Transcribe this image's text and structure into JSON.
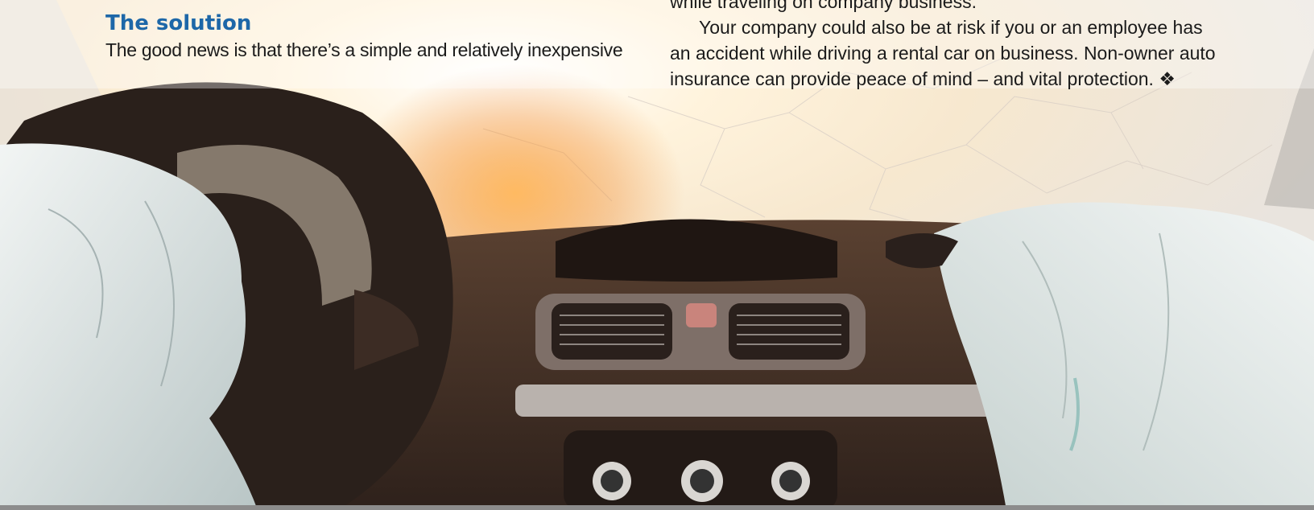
{
  "article": {
    "heading": "The solution",
    "left_text": "The good news is that there’s a simple and relatively inexpensive",
    "right_line_clipped": "while traveling on company business.",
    "right_paragraph_1": "Your company could also be at risk if you or an employee has",
    "right_paragraph_2": "an accident while driving a rental car on business. Non-owner auto",
    "right_paragraph_3": "insurance can provide peace of mind – and vital protection.",
    "end_mark": "❖"
  },
  "photo": {
    "subject": "car-interior-after-crash",
    "colors": {
      "window_glow": "#fff6e6",
      "sun": "#ffb25a",
      "dashboard": "#3b2a22",
      "airbag": "#dfe7e6"
    }
  }
}
